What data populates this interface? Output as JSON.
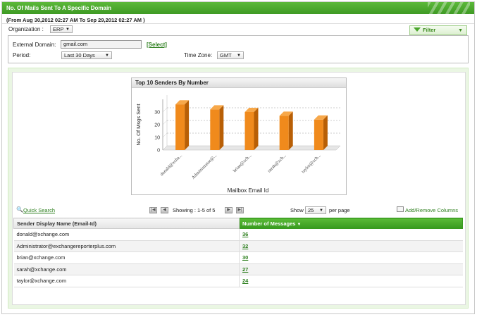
{
  "report": {
    "title": "No. Of Mails Sent To A Specific Domain",
    "date_range": "(From Aug 30,2012 02:27 AM To Sep 29,2012 02:27 AM )"
  },
  "filters": {
    "organization_label": "Organization :",
    "organization_value": "ERP",
    "filter_button": "Filter",
    "external_domain_label": "External Domain:",
    "external_domain_value": "gmail.com",
    "select_link": "[Select]",
    "period_label": "Period:",
    "period_value": "Last 30 Days",
    "timezone_label": "Time Zone:",
    "timezone_value": "GMT"
  },
  "chart_data": {
    "type": "bar",
    "title": "Top 10 Senders By Number",
    "categories": [
      "donald@xcha...",
      "Administrator@...",
      "brian@xch...",
      "sarah@xch...",
      "taylor@xch..."
    ],
    "values": [
      36,
      32,
      30,
      27,
      24
    ],
    "xlabel": "Mailbox Email Id",
    "ylabel": "No. Of Msgs Sent",
    "ylim": [
      0,
      40
    ],
    "yticks": [
      0,
      10,
      20,
      30
    ],
    "color": "#f08a1c",
    "grid": true
  },
  "toolbar": {
    "quick_search": "Quick Search",
    "showing": "Showing : 1-5 of 5",
    "show_label": "Show",
    "page_size": "25",
    "per_page": "per page",
    "add_remove": "Add/Remove Columns"
  },
  "table": {
    "col_sender": "Sender Display Name (Email-Id)",
    "col_count": "Number of Messages",
    "rows": [
      {
        "sender": "donald@xchange.com",
        "count": "36"
      },
      {
        "sender": "Administrator@exchangereporterplus.com",
        "count": "32"
      },
      {
        "sender": "brian@xchange.com",
        "count": "30"
      },
      {
        "sender": "sarah@xchange.com",
        "count": "27"
      },
      {
        "sender": "taylor@xchange.com",
        "count": "24"
      }
    ]
  }
}
